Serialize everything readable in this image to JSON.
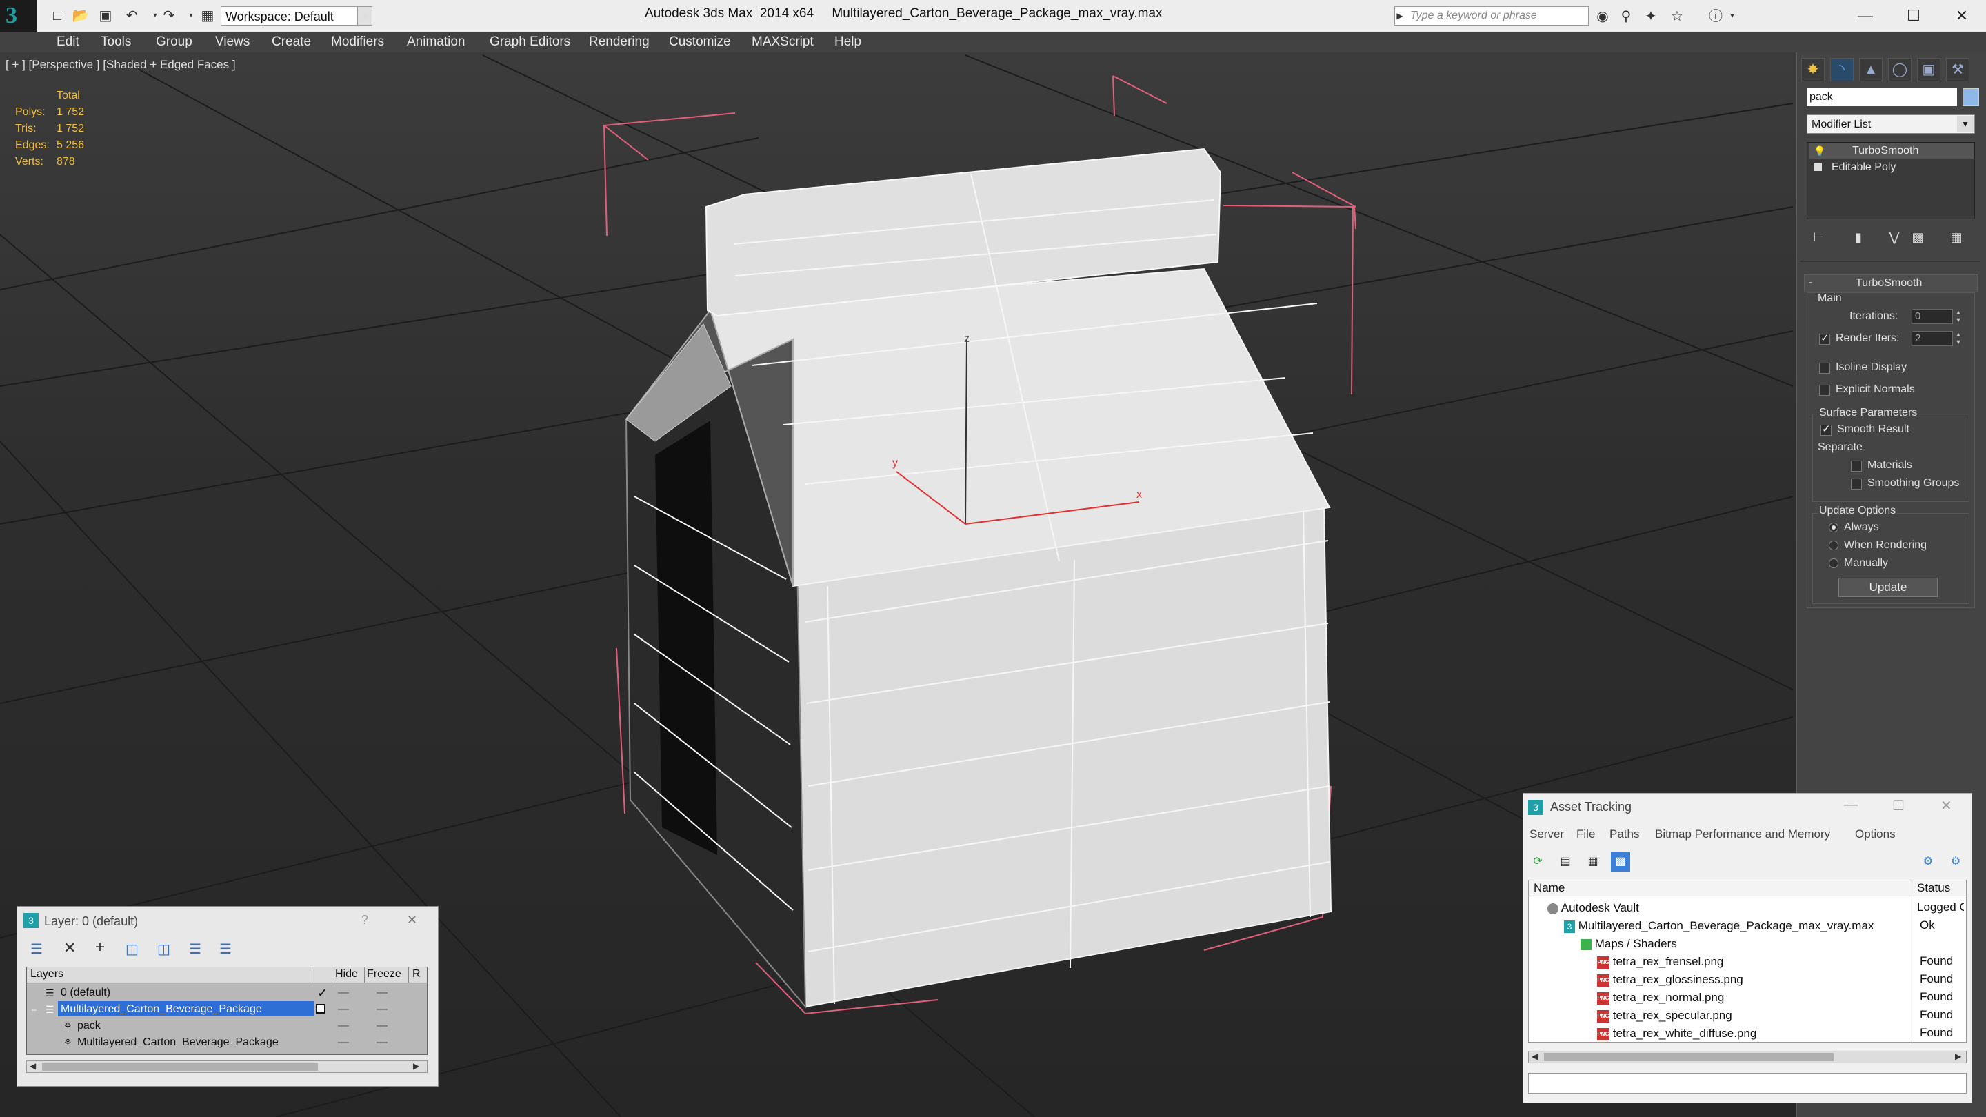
{
  "titlebar": {
    "workspace": "Workspace: Default",
    "title": "Autodesk 3ds Max  2014 x64     Multilayered_Carton_Beverage_Package_max_vray.max",
    "search_placeholder": "Type a keyword or phrase",
    "minimize": "—",
    "maximize": "☐",
    "close": "✕"
  },
  "menu": [
    "Edit",
    "Tools",
    "Group",
    "Views",
    "Create",
    "Modifiers",
    "Animation",
    "Graph Editors",
    "Rendering",
    "Customize",
    "MAXScript",
    "Help"
  ],
  "viewport": {
    "label": "[ + ] [Perspective ] [Shaded + Edged Faces ]",
    "stats_header": "Total",
    "stats": [
      {
        "label": "Polys:",
        "value": "1 752"
      },
      {
        "label": "Tris:",
        "value": "1 752"
      },
      {
        "label": "Edges:",
        "value": "5 256"
      },
      {
        "label": "Verts:",
        "value": "878"
      }
    ],
    "axis_x": "x",
    "axis_y": "y",
    "axis_z": "z"
  },
  "command_panel": {
    "object_name": "pack",
    "modifier_list": "Modifier List",
    "stack": [
      "TurboSmooth",
      "Editable Poly"
    ],
    "rollout_title": "TurboSmooth",
    "main_label": "Main",
    "iterations_label": "Iterations:",
    "iterations_value": "0",
    "render_iters_label": "Render Iters:",
    "render_iters_value": "2",
    "isoline_label": "Isoline Display",
    "explicit_normals_label": "Explicit Normals",
    "surface_params_label": "Surface Parameters",
    "smooth_result_label": "Smooth Result",
    "separate_label": "Separate",
    "materials_label": "Materials",
    "smoothing_groups_label": "Smoothing Groups",
    "update_options_label": "Update Options",
    "always_label": "Always",
    "when_rendering_label": "When Rendering",
    "manually_label": "Manually",
    "update_button": "Update",
    "render_iters_checked": true,
    "smooth_result_checked": true,
    "update_mode": "Always"
  },
  "asset_tracking": {
    "title": "Asset Tracking",
    "menu": [
      "Server",
      "File",
      "Paths",
      "Bitmap Performance and Memory",
      "Options"
    ],
    "col_name": "Name",
    "col_status": "Status",
    "rows": [
      {
        "name": "Autodesk Vault",
        "status": "Logged O",
        "level": 1,
        "icon": "vault-icon"
      },
      {
        "name": "Multilayered_Carton_Beverage_Package_max_vray.max",
        "status": "Ok",
        "level": 2,
        "icon": "max-file-icon"
      },
      {
        "name": "Maps / Shaders",
        "status": "",
        "level": 3,
        "icon": "maps-folder-icon"
      },
      {
        "name": "tetra_rex_frensel.png",
        "status": "Found",
        "level": 4,
        "icon": "png-icon"
      },
      {
        "name": "tetra_rex_glossiness.png",
        "status": "Found",
        "level": 4,
        "icon": "png-icon"
      },
      {
        "name": "tetra_rex_normal.png",
        "status": "Found",
        "level": 4,
        "icon": "png-icon"
      },
      {
        "name": "tetra_rex_specular.png",
        "status": "Found",
        "level": 4,
        "icon": "png-icon"
      },
      {
        "name": "tetra_rex_white_diffuse.png",
        "status": "Found",
        "level": 4,
        "icon": "png-icon"
      }
    ]
  },
  "layer_window": {
    "title": "Layer: 0 (default)",
    "help": "?",
    "close": "✕",
    "col_layers": "Layers",
    "col_hide": "Hide",
    "col_freeze": "Freeze",
    "col_r": "R",
    "rows": [
      {
        "name": "0 (default)",
        "selected": false,
        "level": 0
      },
      {
        "name": "Multilayered_Carton_Beverage_Package",
        "selected": true,
        "level": 0
      },
      {
        "name": "pack",
        "selected": false,
        "level": 1
      },
      {
        "name": "Multilayered_Carton_Beverage_Package",
        "selected": false,
        "level": 1
      }
    ]
  },
  "colors": {
    "selection_blue": "#2e6fd6",
    "stat_yellow": "#f0c040",
    "bbox_pink": "#e0607a",
    "axis_red": "#e03030"
  }
}
